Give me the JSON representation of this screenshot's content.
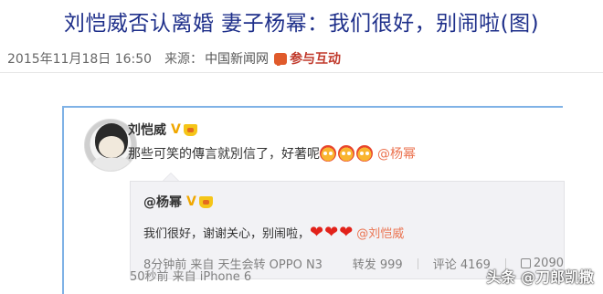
{
  "article": {
    "title": "刘恺威否认离婚 妻子杨幂：我们很好，别闹啦(图)",
    "date": "2015年11月18日 16:50",
    "source_label": "来源：",
    "source_name": "中国新闻网",
    "interact_label": "参与互动"
  },
  "weibo": {
    "author": "刘恺威",
    "verified_mark": "V",
    "text": "那些可笑的傳言就別信了，好著呢",
    "mention": "@杨幂",
    "time_source": "50秒前 来自 iPhone 6",
    "repost": {
      "author": "@杨幂",
      "verified_mark": "V",
      "text": "我们很好，谢谢关心，别闹啦，",
      "mention": "@刘恺威",
      "time_source": "8分钟前 来自 天生会转 OPPO N3",
      "repost_label": "转发 999",
      "comment_label": "评论 4169",
      "like_label": "2090"
    }
  },
  "watermark": "头条 @刀郎凯撒"
}
